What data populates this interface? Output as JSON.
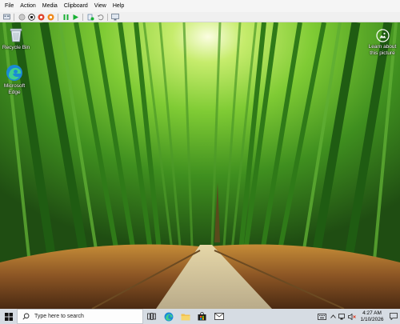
{
  "menubar": {
    "items": [
      "File",
      "Action",
      "Media",
      "Clipboard",
      "View",
      "Help"
    ]
  },
  "toolbar": {
    "buttons": [
      "ctrl-alt-del-icon",
      "start-icon",
      "turn-off-icon",
      "shut-down-icon",
      "save-icon",
      "pause-icon",
      "reset-icon",
      "checkpoint-icon",
      "revert-icon",
      "enhanced-session-icon"
    ]
  },
  "desktop": {
    "icons": [
      {
        "label": "Recycle Bin",
        "icon": "recycle-bin-icon"
      },
      {
        "label": "Microsoft Edge",
        "icon": "edge-icon"
      }
    ],
    "learn_label": "Learn about this picture",
    "learn_icon": "camera-icon"
  },
  "taskbar": {
    "search_placeholder": "Type here to search",
    "pinned": [
      "task-view-icon",
      "edge-icon",
      "file-explorer-icon",
      "store-icon",
      "mail-icon"
    ],
    "tray": [
      "keyboard-icon",
      "chevron-up-icon",
      "network-icon",
      "volume-muted-icon"
    ],
    "time": "4:27 AM",
    "date": "1/10/2026",
    "notification_icon": "notification-icon"
  },
  "colors": {
    "taskbar": "#d6dce3",
    "menubar": "#f5f5f5",
    "accent_green": "#17b033",
    "accent_red": "#e0442c",
    "windows_blue": "#1a8ad6"
  }
}
